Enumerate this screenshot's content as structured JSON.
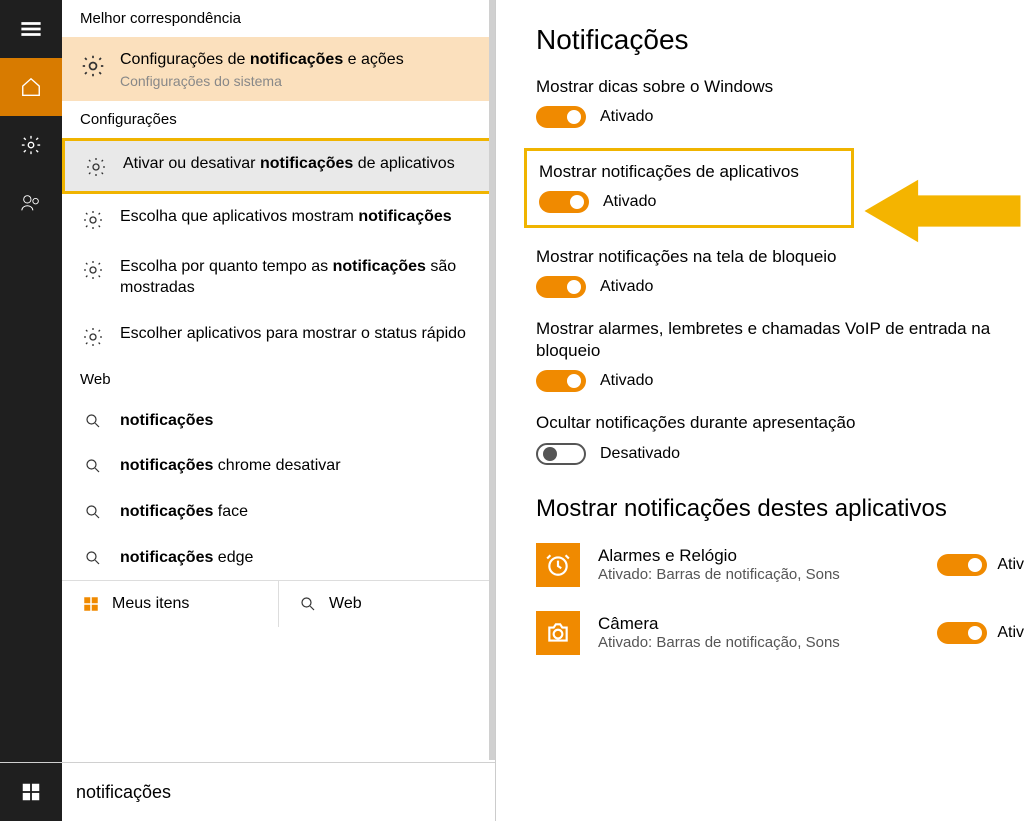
{
  "search": {
    "best_match_header": "Melhor correspondência",
    "best_title_pre": "Configurações de ",
    "best_title_bold": "notificações",
    "best_title_post": " e ações",
    "best_subtitle": "Configurações do sistema",
    "settings_header": "Configurações",
    "r1_pre": "Ativar ou desativar ",
    "r1_bold": "notificações",
    "r1_post": " de aplicativos",
    "r2_pre": "Escolha que aplicativos mostram ",
    "r2_bold": "notificações",
    "r3_pre": "Escolha por quanto tempo as ",
    "r3_bold": "notificações",
    "r3_post": " são mostradas",
    "r4": "Escolher aplicativos para mostrar o status rápido",
    "web_header": "Web",
    "w1_bold": "notificações",
    "w2_bold": "notificações",
    "w2_post": " chrome desativar",
    "w3_bold": "notificações",
    "w3_post": " face",
    "w4_bold": "notificações",
    "w4_post": " edge",
    "footer_my": "Meus itens",
    "footer_web": "Web",
    "query": "notificações"
  },
  "panel": {
    "title": "Notificações",
    "s1_label": "Mostrar dicas sobre o Windows",
    "s1_state": "Ativado",
    "s2_label": "Mostrar notificações de aplicativos",
    "s2_state": "Ativado",
    "s3_label": "Mostrar notificações na tela de bloqueio",
    "s3_state": "Ativado",
    "s4_label": "Mostrar alarmes, lembretes e chamadas VoIP de entrada na bloqueio",
    "s4_state": "Ativado",
    "s5_label": "Ocultar notificações durante apresentação",
    "s5_state": "Desativado",
    "apps_title": "Mostrar notificações destes aplicativos",
    "app1_name": "Alarmes e Relógio",
    "app1_sub": "Ativado: Barras de notificação, Sons",
    "app1_short": "Ativ",
    "app2_name": "Câmera",
    "app2_sub": "Ativado: Barras de notificação, Sons",
    "app2_short": "Ativ"
  }
}
